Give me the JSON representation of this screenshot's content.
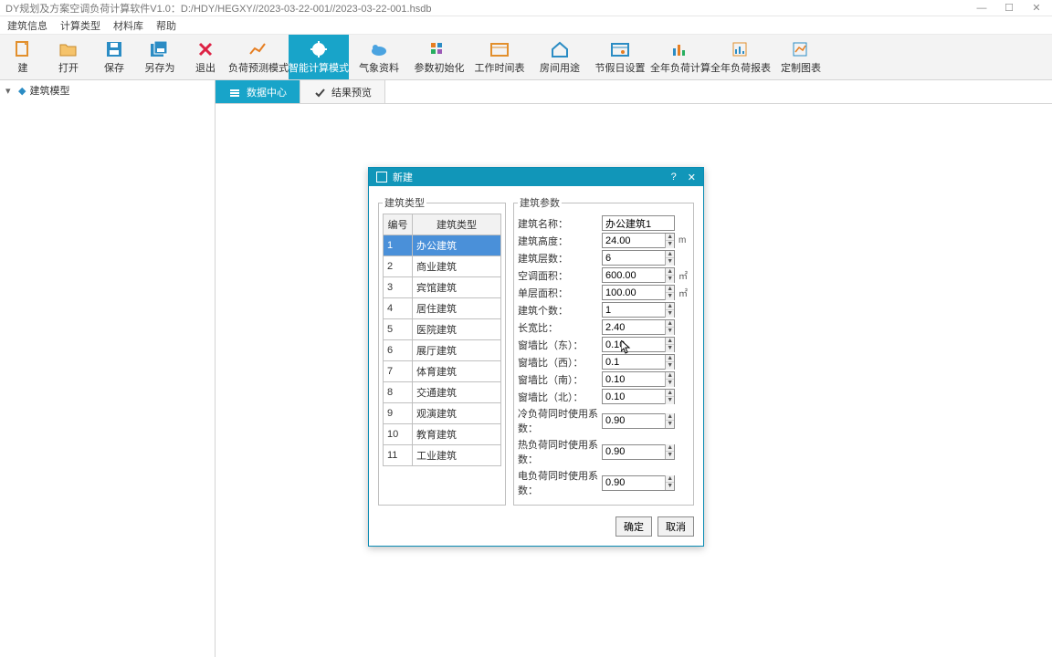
{
  "window": {
    "title": "DY规划及方案空调负荷计算软件V1.0：D:/HDY/HEGXY//2023-03-22-001//2023-03-22-001.hsdb"
  },
  "menu": [
    "建筑信息",
    "计算类型",
    "材料库",
    "帮助"
  ],
  "toolbar": [
    {
      "label": "建",
      "name": "new"
    },
    {
      "label": "打开",
      "name": "open"
    },
    {
      "label": "保存",
      "name": "save"
    },
    {
      "label": "另存为",
      "name": "saveas"
    },
    {
      "label": "退出",
      "name": "exit"
    },
    {
      "label": "负荷预测模式",
      "name": "mode-forecast",
      "wide": true
    },
    {
      "label": "智能计算模式",
      "name": "mode-smart",
      "wide": true,
      "active": true
    },
    {
      "label": "气象资料",
      "name": "weather",
      "wide": true
    },
    {
      "label": "参数初始化",
      "name": "init-params",
      "wide": true
    },
    {
      "label": "工作时间表",
      "name": "work-schedule",
      "wide": true
    },
    {
      "label": "房间用途",
      "name": "room-use",
      "wide": true
    },
    {
      "label": "节假日设置",
      "name": "holiday",
      "wide": true
    },
    {
      "label": "全年负荷计算",
      "name": "year-calc",
      "wide": true
    },
    {
      "label": "全年负荷报表",
      "name": "year-report",
      "wide": true
    },
    {
      "label": "定制图表",
      "name": "custom-chart",
      "wide": true
    }
  ],
  "tree": {
    "root": "建筑模型"
  },
  "tabs": [
    {
      "label": "数据中心",
      "active": true
    },
    {
      "label": "结果预览",
      "active": false
    }
  ],
  "dialog": {
    "title": "新建",
    "left_legend": "建筑类型",
    "right_legend": "建筑参数",
    "headers": {
      "id": "编号",
      "type": "建筑类型"
    },
    "types": [
      {
        "id": "1",
        "name": "办公建筑",
        "sel": true
      },
      {
        "id": "2",
        "name": "商业建筑"
      },
      {
        "id": "3",
        "name": "宾馆建筑"
      },
      {
        "id": "4",
        "name": "居住建筑"
      },
      {
        "id": "5",
        "name": "医院建筑"
      },
      {
        "id": "6",
        "name": "展厅建筑"
      },
      {
        "id": "7",
        "name": "体育建筑"
      },
      {
        "id": "8",
        "name": "交通建筑"
      },
      {
        "id": "9",
        "name": "观演建筑"
      },
      {
        "id": "10",
        "name": "教育建筑"
      },
      {
        "id": "11",
        "name": "工业建筑"
      }
    ],
    "params": [
      {
        "label": "建筑名称：",
        "value": "办公建筑1",
        "unit": "",
        "spin": false
      },
      {
        "label": "建筑高度：",
        "value": "24.00",
        "unit": "m",
        "spin": true
      },
      {
        "label": "建筑层数：",
        "value": "6",
        "unit": "",
        "spin": true
      },
      {
        "label": "空调面积：",
        "value": "600.00",
        "unit": "㎡",
        "spin": true
      },
      {
        "label": "单层面积：",
        "value": "100.00",
        "unit": "㎡",
        "spin": true
      },
      {
        "label": "建筑个数：",
        "value": "1",
        "unit": "",
        "spin": true
      },
      {
        "label": "长宽比：",
        "value": "2.40",
        "unit": "",
        "spin": true
      },
      {
        "label": "窗墙比（东）：",
        "value": "0.10",
        "unit": "",
        "spin": true
      },
      {
        "label": "窗墙比（西）：",
        "value": "0.1",
        "unit": "",
        "spin": true
      },
      {
        "label": "窗墙比（南）：",
        "value": "0.10",
        "unit": "",
        "spin": true
      },
      {
        "label": "窗墙比（北）：",
        "value": "0.10",
        "unit": "",
        "spin": true
      },
      {
        "label": "冷负荷同时使用系数：",
        "value": "0.90",
        "unit": "",
        "spin": true
      },
      {
        "label": "热负荷同时使用系数：",
        "value": "0.90",
        "unit": "",
        "spin": true
      },
      {
        "label": "电负荷同时使用系数：",
        "value": "0.90",
        "unit": "",
        "spin": true
      }
    ],
    "ok": "确定",
    "cancel": "取消"
  }
}
